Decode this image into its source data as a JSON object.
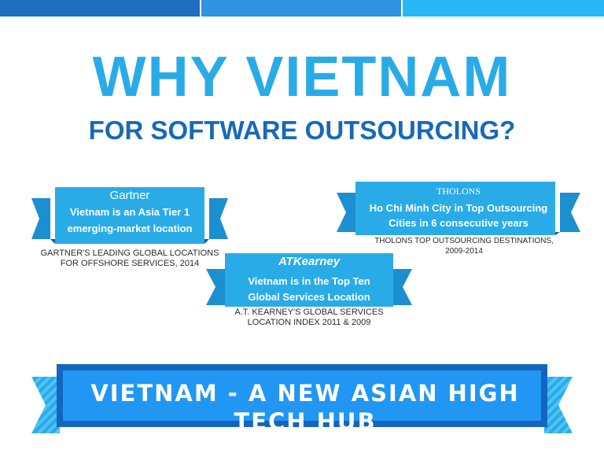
{
  "title": "WHY VIETNAM",
  "subtitle": "FOR SOFTWARE OUTSOURCING?",
  "badges": [
    {
      "brand": "Gartner",
      "lines": [
        "Vietnam is an Asia Tier 1",
        "emerging-market location"
      ],
      "caption": [
        "GARTNER'S LEADING GLOBAL LOCATIONS",
        "FOR OFFSHORE SERVICES, 2014"
      ]
    },
    {
      "brand": "THOLONS",
      "lines": [
        "Ho Chi Minh City in Top Outsourcing",
        "Cities in 6 consecutive years"
      ],
      "caption": [
        "THOLONS TOP OUTSOURCING DESTINATIONS,",
        "2009-2014"
      ]
    },
    {
      "brand": "ATKearney",
      "lines": [
        "Vietnam is in the Top Ten",
        "Global Services Location"
      ],
      "caption": [
        "A.T. KEARNEY'S GLOBAL SERVICES",
        "LOCATION INDEX 2011 & 2009"
      ]
    }
  ],
  "banner": "VIETNAM - A NEW ASIAN HIGH TECH HUB",
  "colors": {
    "ribbon_front": "#29abe8",
    "ribbon_back": "#1b8fd0",
    "banner_front": "#2196f3",
    "banner_border": "#1565c0",
    "title": "#29abe8",
    "subtitle": "#1769b8"
  }
}
